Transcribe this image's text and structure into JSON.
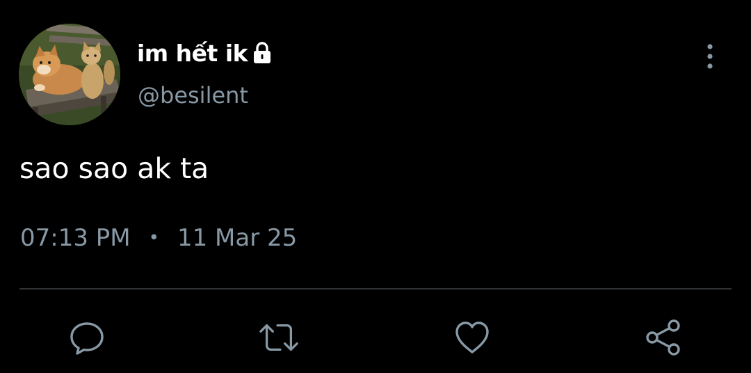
{
  "user": {
    "display_name": "im hết ik",
    "handle": "@besilent"
  },
  "tweet": {
    "text": "sao sao ak ta",
    "time": "07:13 PM",
    "separator": "•",
    "date": "11 Mar 25"
  },
  "icons": {
    "lock": "lock-icon",
    "more": "more-vertical-icon",
    "reply": "reply-icon",
    "retweet": "retweet-icon",
    "like": "heart-icon",
    "share": "share-icon"
  },
  "colors": {
    "background": "#000000",
    "text": "#ffffff",
    "secondary": "#8899a6",
    "divider": "#2f3336"
  }
}
